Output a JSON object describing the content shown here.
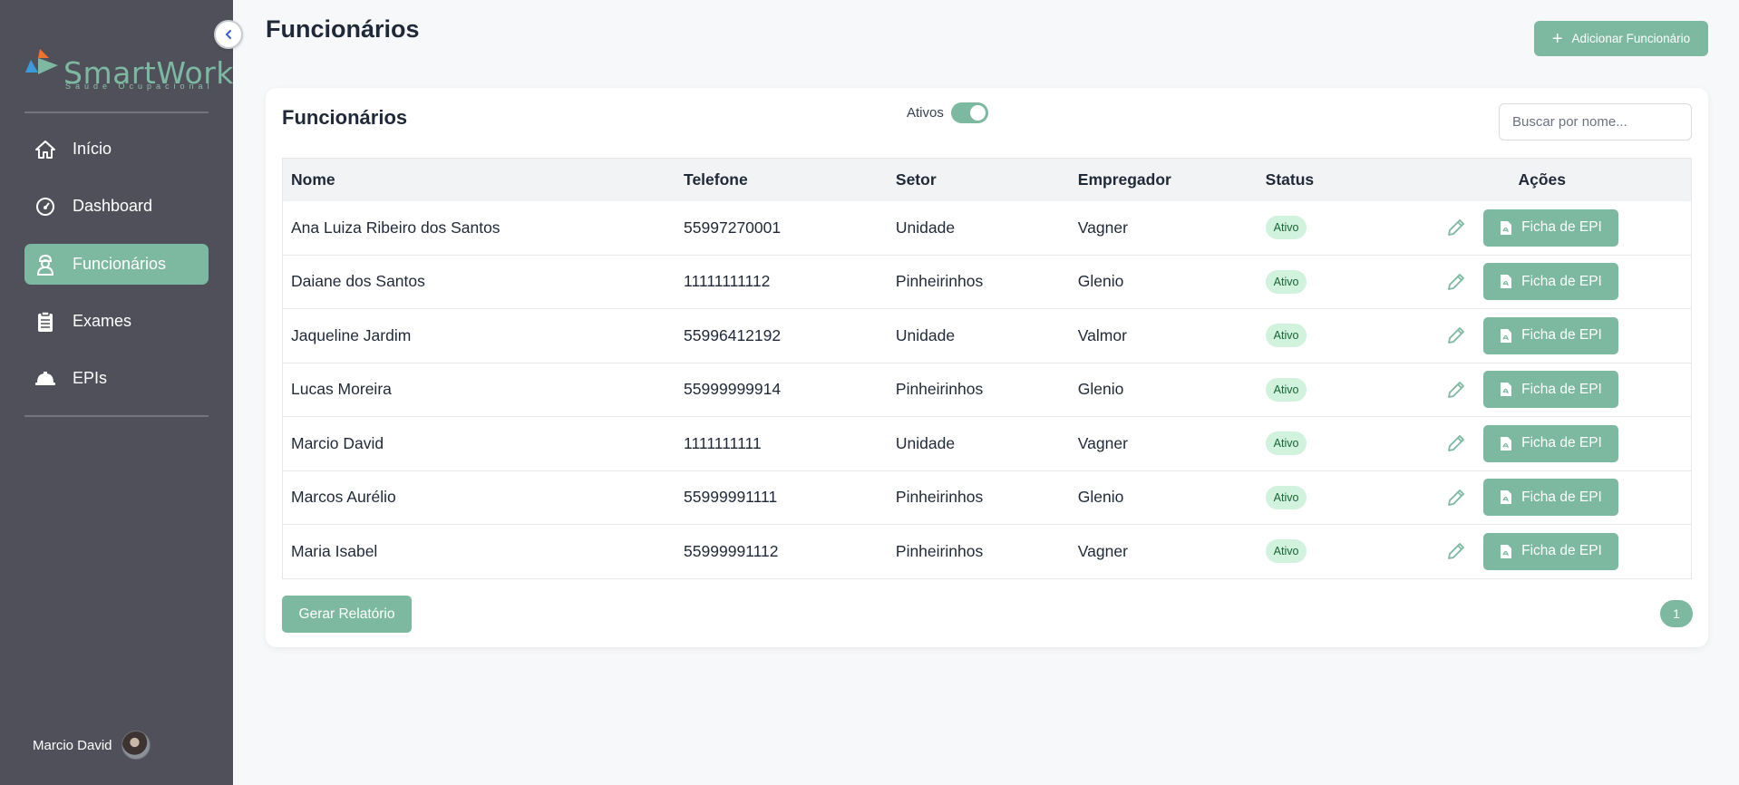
{
  "brand": {
    "name": "SmartWork",
    "tagline": "Saúde Ocupacional",
    "colors": {
      "accent": "#7db8a0",
      "sidebar": "#4f505a",
      "logo_orange": "#f2712b",
      "logo_blue": "#3a9bdc",
      "logo_green": "#7db8a0"
    }
  },
  "sidebar": {
    "items": [
      {
        "label": "Início",
        "icon": "home-icon",
        "active": false
      },
      {
        "label": "Dashboard",
        "icon": "gauge-icon",
        "active": false
      },
      {
        "label": "Funcionários",
        "icon": "worker-icon",
        "active": true
      },
      {
        "label": "Exames",
        "icon": "clipboard-icon",
        "active": false
      },
      {
        "label": "EPIs",
        "icon": "helmet-icon",
        "active": false
      }
    ],
    "user_name": "Marcio David"
  },
  "header": {
    "title": "Funcionários",
    "add_button": "Adicionar Funcionário"
  },
  "card": {
    "title": "Funcionários",
    "toggle_label": "Ativos",
    "toggle_on": true,
    "search_placeholder": "Buscar por nome...",
    "columns": [
      "Nome",
      "Telefone",
      "Setor",
      "Empregador",
      "Status",
      "Ações"
    ],
    "rows": [
      {
        "nome": "Ana Luiza Ribeiro dos Santos",
        "telefone": "55997270001",
        "setor": "Unidade",
        "empregador": "Vagner",
        "status": "Ativo"
      },
      {
        "nome": "Daiane dos Santos",
        "telefone": "11111111112",
        "setor": "Pinheirinhos",
        "empregador": "Glenio",
        "status": "Ativo"
      },
      {
        "nome": "Jaqueline Jardim",
        "telefone": "55996412192",
        "setor": "Unidade",
        "empregador": "Valmor",
        "status": "Ativo"
      },
      {
        "nome": "Lucas Moreira",
        "telefone": "55999999914",
        "setor": "Pinheirinhos",
        "empregador": "Glenio",
        "status": "Ativo"
      },
      {
        "nome": "Marcio David",
        "telefone": "1111111111",
        "setor": "Unidade",
        "empregador": "Vagner",
        "status": "Ativo"
      },
      {
        "nome": "Marcos Aurélio",
        "telefone": "55999991111",
        "setor": "Pinheirinhos",
        "empregador": "Glenio",
        "status": "Ativo"
      },
      {
        "nome": "Maria Isabel",
        "telefone": "55999991112",
        "setor": "Pinheirinhos",
        "empregador": "Vagner",
        "status": "Ativo"
      }
    ],
    "epi_button": "Ficha de EPI",
    "report_button": "Gerar Relatório",
    "page": "1"
  }
}
